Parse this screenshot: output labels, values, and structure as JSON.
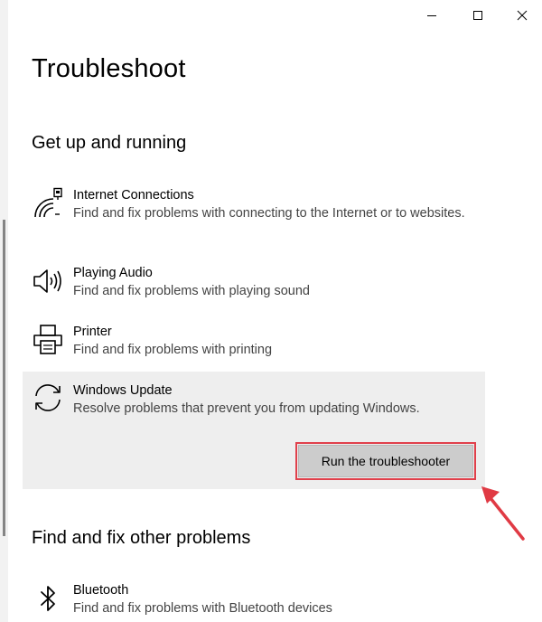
{
  "window": {
    "minimize_glyph": "–",
    "maximize_glyph": "☐",
    "close_glyph": "✕"
  },
  "page_title": "Troubleshoot",
  "sections": [
    {
      "heading": "Get up and running",
      "items": [
        {
          "icon": "wifi-ethernet-icon",
          "title": "Internet Connections",
          "description": "Find and fix problems with connecting to the Internet or to websites."
        },
        {
          "icon": "speaker-icon",
          "title": "Playing Audio",
          "description": "Find and fix problems with playing sound"
        },
        {
          "icon": "printer-icon",
          "title": "Printer",
          "description": "Find and fix problems with printing"
        },
        {
          "icon": "sync-icon",
          "title": "Windows Update",
          "description": "Resolve problems that prevent you from updating Windows.",
          "expanded": true,
          "action_label": "Run the troubleshooter"
        }
      ]
    },
    {
      "heading": "Find and fix other problems",
      "items": [
        {
          "icon": "bluetooth-icon",
          "title": "Bluetooth",
          "description": "Find and fix problems with Bluetooth devices"
        }
      ]
    }
  ],
  "annotation": {
    "highlight_color": "#e0404b",
    "arrow_icon": "red-arrow-icon"
  }
}
